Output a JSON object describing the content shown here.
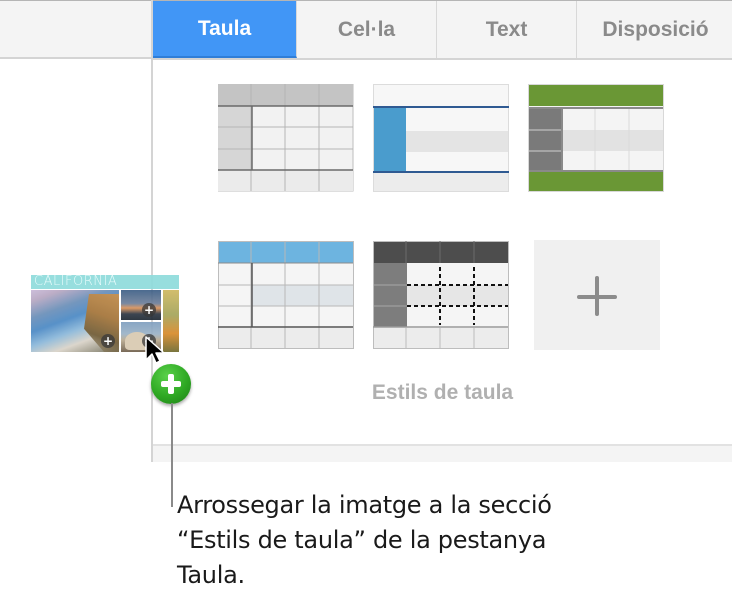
{
  "tabs": [
    {
      "label": "Taula",
      "active": true
    },
    {
      "label": "Cel·la",
      "active": false
    },
    {
      "label": "Text",
      "active": false
    },
    {
      "label": "Disposició",
      "active": false
    }
  ],
  "table_styles": {
    "section_label": "Estils de taula",
    "styles": [
      {
        "name": "gray-header-style",
        "header_color": "#c4c4c4",
        "body_color": "#f2f2f2"
      },
      {
        "name": "blue-column-style",
        "accent_color": "#4a9ccd",
        "rule_color": "#2f5a92"
      },
      {
        "name": "green-header-footer-style",
        "accent_color": "#6a9735",
        "column_color": "#7a7a7a"
      },
      {
        "name": "light-blue-header-style",
        "header_color": "#6db4e0",
        "body_color": "#f4f4f4"
      },
      {
        "name": "dark-dashed-style",
        "header_color": "#4d4d4d",
        "column_color": "#7d7d7d"
      }
    ],
    "add_style_icon": "plus-icon"
  },
  "dragged_image": {
    "title": "CALIFORNIA",
    "placeholder_icon": "plus-icon"
  },
  "drag_badge_icon": "green-plus-icon",
  "callout": {
    "text": "Arrossegar la imatge a la secció “Estils de taula” de la pestanya Taula."
  }
}
